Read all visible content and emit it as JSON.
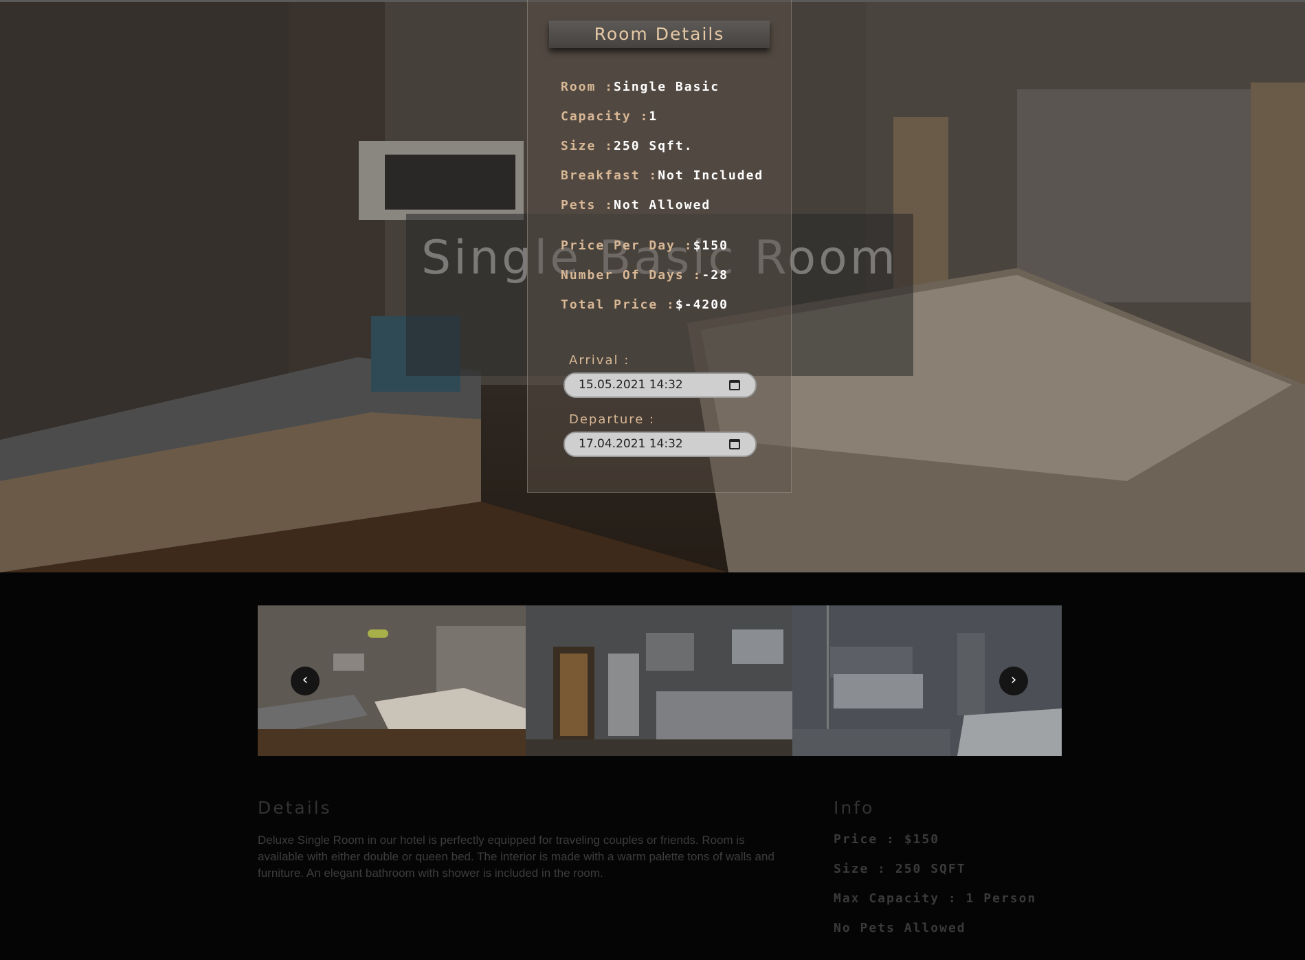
{
  "hero": {
    "title": "Single Basic Room"
  },
  "panel": {
    "header": "Room Details",
    "rows": [
      {
        "label": "Room :",
        "value": "Single Basic"
      },
      {
        "label": "Capacity :",
        "value": "1"
      },
      {
        "label": "Size :",
        "value": "250 Sqft."
      },
      {
        "label": "Breakfast :",
        "value": "Not Included"
      },
      {
        "label": "Pets :",
        "value": "Not Allowed"
      },
      {
        "label": "Price Per Day :",
        "value": "$150"
      },
      {
        "label": "Number Of Days :",
        "value": "-28"
      },
      {
        "label": "Total Price :",
        "value": "$-4200"
      }
    ],
    "arrival": {
      "label": "Arrival :",
      "value": "15.05.2021 14:32"
    },
    "departure": {
      "label": "Departure :",
      "value": "17.04.2021 14:32"
    }
  },
  "carousel": {
    "prev_icon": "chevron-left-icon",
    "next_icon": "chevron-right-icon",
    "prev_glyph": "‹",
    "next_glyph": "›"
  },
  "details": {
    "title": "Details",
    "text": "Deluxe Single Room in our hotel is perfectly equipped for traveling couples or friends. Room is available with either double or queen bed. The interior is made with a warm palette tons of walls and furniture. An elegant bathroom with shower is included in the room."
  },
  "info": {
    "title": "Info",
    "items": [
      "Price : $150",
      "Size : 250 SQFT",
      "Max Capacity : 1 Person",
      "No Pets Allowed"
    ]
  },
  "colors": {
    "accent_label": "#d9b896",
    "header_text": "#e6c9a6",
    "page_bg": "#050505"
  }
}
